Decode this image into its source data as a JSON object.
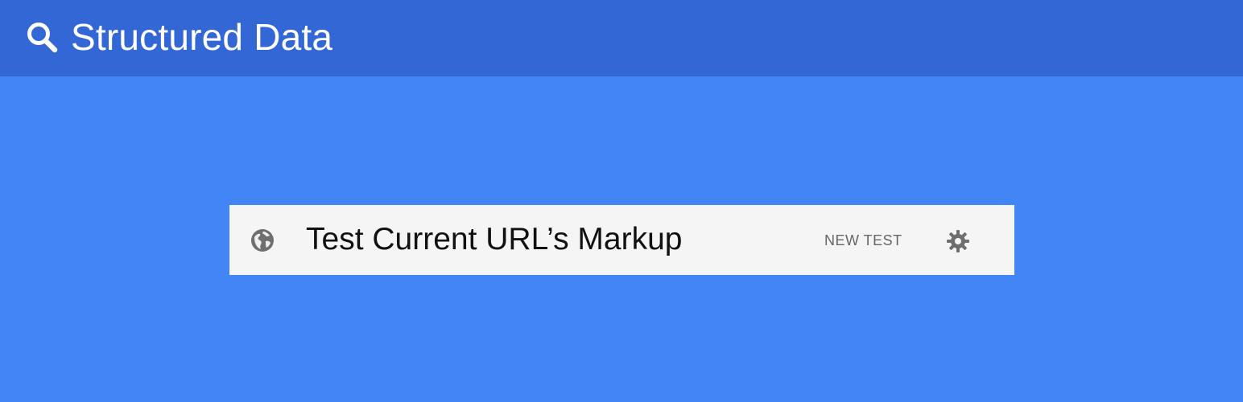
{
  "header": {
    "title": "Structured Data",
    "icon": "search-icon",
    "background": "#3367d6",
    "text_color": "#ffffff"
  },
  "page": {
    "background": "#4285f4"
  },
  "card": {
    "background": "#f5f5f5",
    "icon": "globe-icon",
    "label": "Test Current URL’s Markup",
    "new_test_label": "NEW TEST",
    "settings_icon": "gear-icon"
  }
}
